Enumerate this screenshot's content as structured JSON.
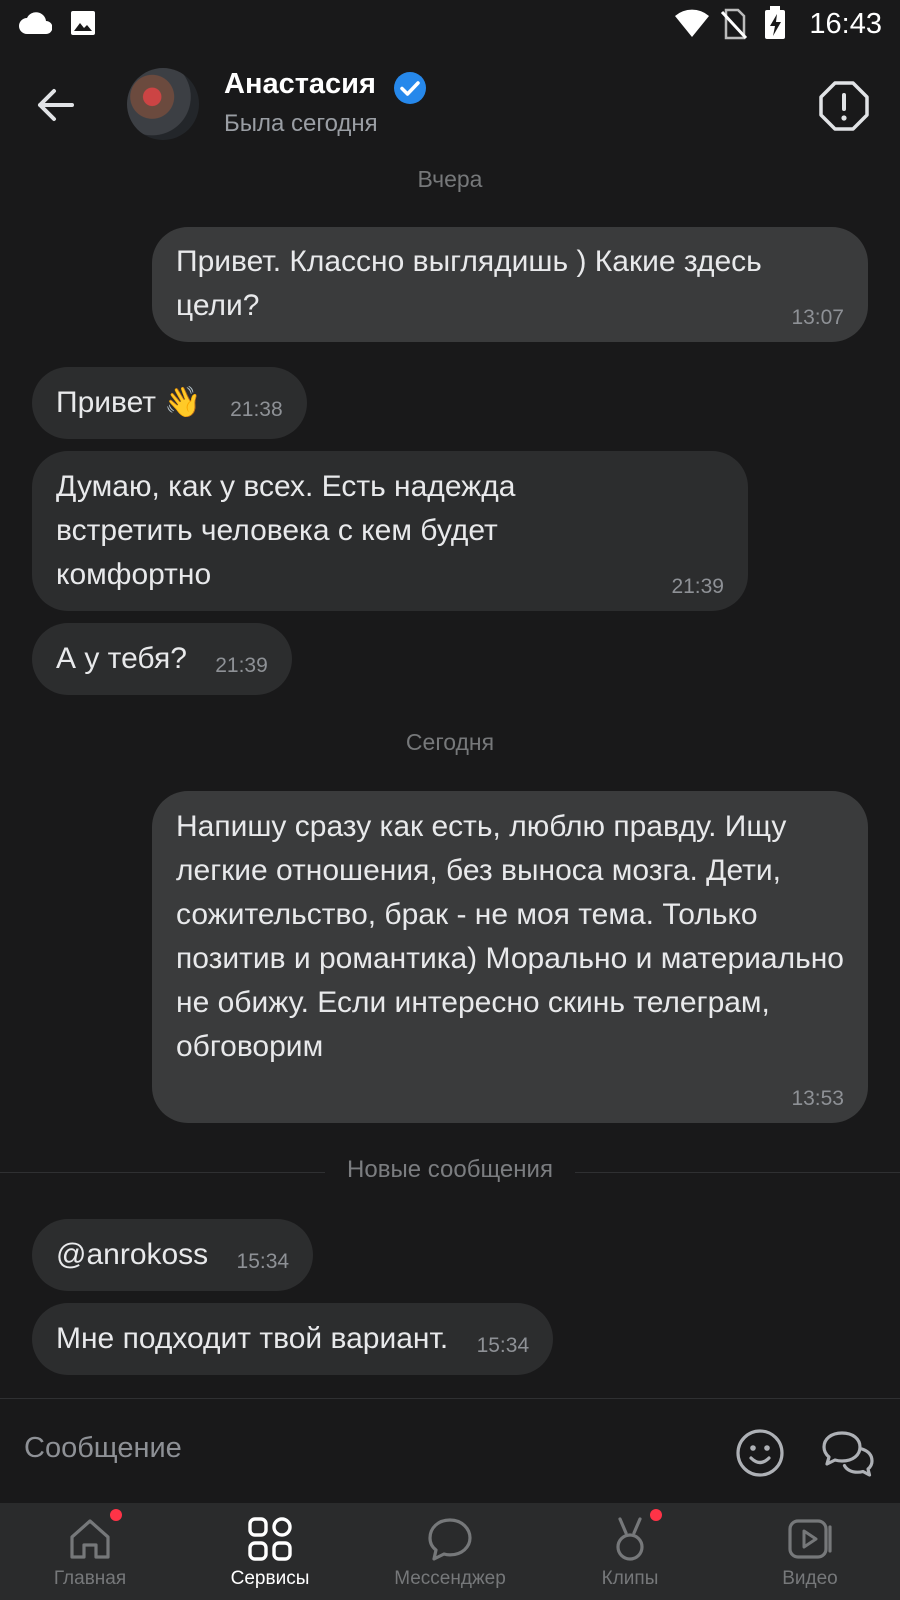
{
  "status_bar": {
    "time": "16:43"
  },
  "header": {
    "name": "Анастасия",
    "last_seen": "Была сегодня"
  },
  "chat": {
    "date_yesterday": "Вчера",
    "date_today": "Сегодня",
    "new_messages_label": "Новые сообщения",
    "messages": [
      {
        "dir": "out",
        "text": "Привет. Классно выглядишь ) Какие здесь цели?",
        "time": "13:07"
      },
      {
        "dir": "in",
        "text": "Привет",
        "emoji": "👋",
        "time": "21:38"
      },
      {
        "dir": "in",
        "text": "Думаю, как у всех. Есть надежда встретить человека с кем будет комфортно",
        "time": "21:39"
      },
      {
        "dir": "in",
        "text": "А у тебя?",
        "time": "21:39"
      },
      {
        "dir": "out",
        "text": "Напишу сразу как есть, люблю правду. Ищу легкие отношения, без выноса мозга. Дети, сожительство, брак - не моя тема. Только позитив и романтика) Морально и материально не обижу. Если интересно скинь телеграм, обговорим",
        "time": "13:53"
      },
      {
        "dir": "in",
        "text": "@anrokoss",
        "time": "15:34"
      },
      {
        "dir": "in",
        "text": "Мне подходит твой вариант.",
        "time": "15:34"
      }
    ]
  },
  "composer": {
    "placeholder": "Сообщение"
  },
  "nav": {
    "items": [
      {
        "label": "Главная",
        "icon": "home-icon",
        "badge": true
      },
      {
        "label": "Сервисы",
        "icon": "services-grid-icon",
        "active": true
      },
      {
        "label": "Мессенджер",
        "icon": "messenger-icon"
      },
      {
        "label": "Клипы",
        "icon": "clips-icon",
        "badge": true
      },
      {
        "label": "Видео",
        "icon": "video-icon"
      }
    ]
  },
  "colors": {
    "background": "#19191a",
    "incoming_bubble": "#2c2d2e",
    "outgoing_bubble": "#3a3b3c",
    "badge": "#ff3347",
    "verified": "#2688eb"
  }
}
